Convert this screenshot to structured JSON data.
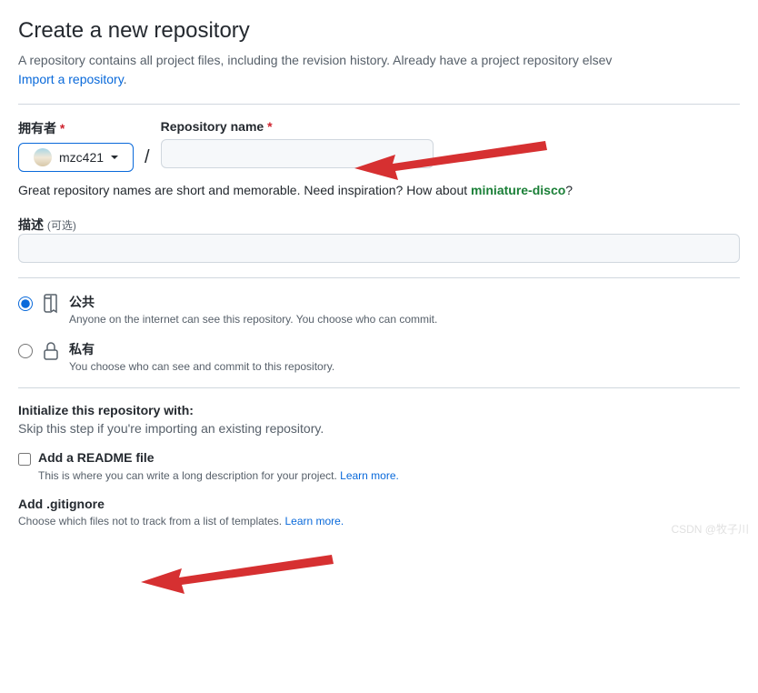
{
  "header": {
    "title": "Create a new repository",
    "subtitle_prefix": "A repository contains all project files, including the revision history. Already have a project repository elsev",
    "import_link": "Import a repository",
    "period": "."
  },
  "owner": {
    "label": "拥有者",
    "username": "mzc421"
  },
  "repo_name": {
    "label": "Repository name"
  },
  "hint": {
    "text_before": "Great repository names are short and memorable. Need inspiration? How about ",
    "suggestion": "miniature-disco",
    "text_after": "?"
  },
  "description": {
    "label": "描述",
    "optional": "(可选)"
  },
  "visibility": {
    "public": {
      "title": "公共",
      "desc": "Anyone on the internet can see this repository. You choose who can commit."
    },
    "private": {
      "title": "私有",
      "desc": "You choose who can see and commit to this repository."
    }
  },
  "initialize": {
    "heading": "Initialize this repository with:",
    "sub": "Skip this step if you're importing an existing repository."
  },
  "readme": {
    "label": "Add a README file",
    "desc_prefix": "This is where you can write a long description for your project. ",
    "learn_more": "Learn more."
  },
  "gitignore": {
    "heading": "Add .gitignore",
    "desc_prefix": "Choose which files not to track from a list of templates. ",
    "learn_more": "Learn more."
  },
  "watermark": "CSDN @牧子川"
}
